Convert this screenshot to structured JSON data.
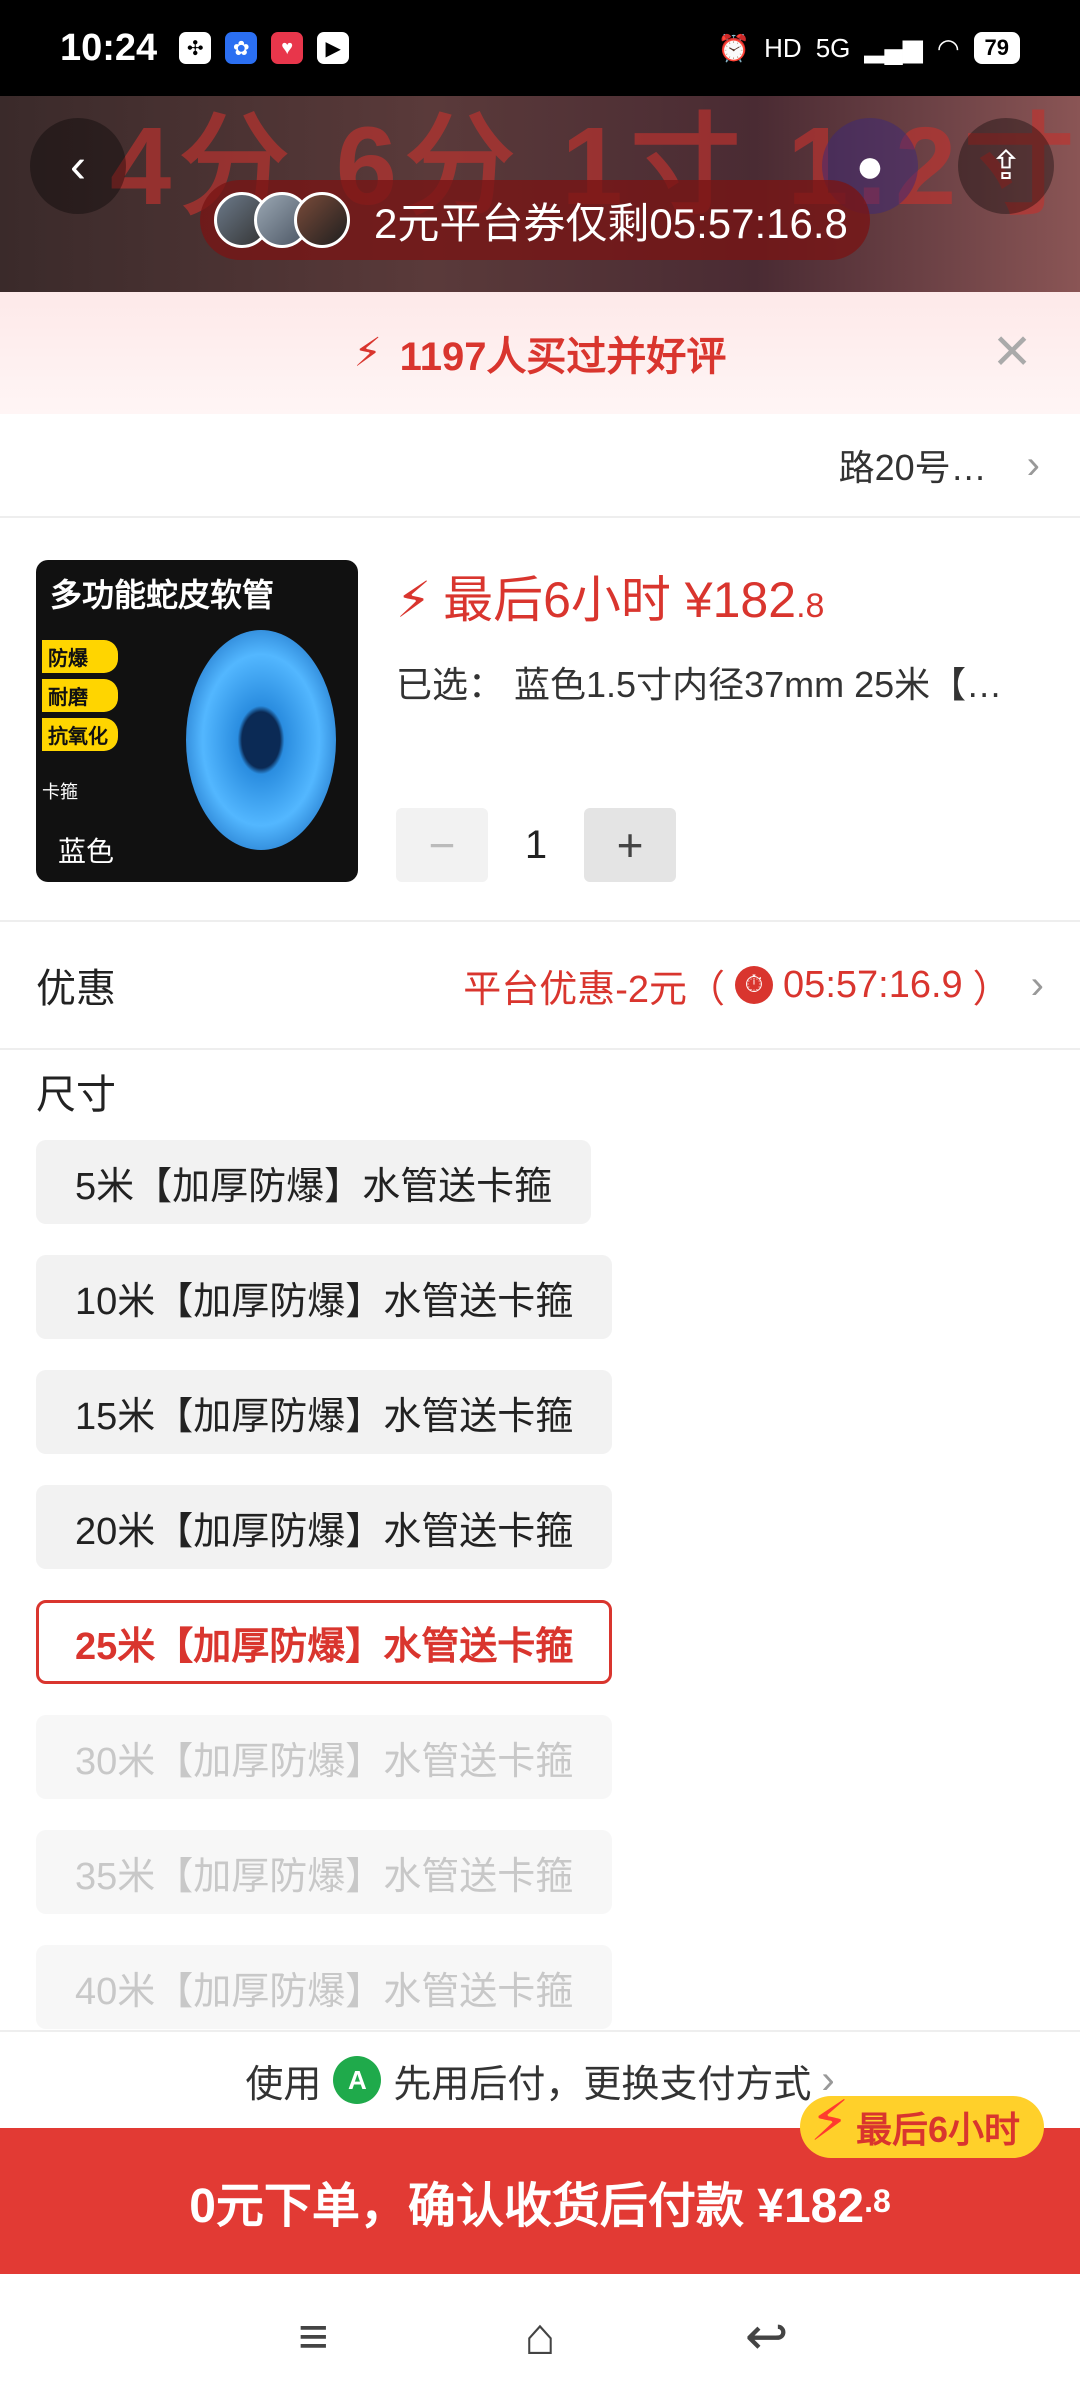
{
  "status_bar": {
    "time": "10:24",
    "network": "5G",
    "battery": "79"
  },
  "banner": {
    "bg_text": "4分 6分 1寸 1.2寸",
    "coupon_text": "2元平台券仅剩05:57:16.8"
  },
  "sales_strip": {
    "text": "1197人买过并好评"
  },
  "address": {
    "text": "路20号…"
  },
  "product": {
    "thumb_title": "多功能蛇皮软管",
    "thumb_tags": [
      "防爆",
      "耐磨",
      "抗氧化"
    ],
    "thumb_clamp": "卡箍",
    "thumb_color": "蓝色",
    "price_prefix": "最后6小时 ¥",
    "price_main": "182",
    "price_decimal": ".8",
    "selected_label": "已选：",
    "selected_value": "蓝色1.5寸内径37mm 25米【…",
    "quantity": "1",
    "minus": "−",
    "plus": "+"
  },
  "promotion": {
    "label": "优惠",
    "value": "平台优惠-2元（",
    "countdown": "05:57:16.9",
    "close_paren": "）"
  },
  "size": {
    "title": "尺寸",
    "options": [
      {
        "label": "5米【加厚防爆】水管送卡箍",
        "state": "normal"
      },
      {
        "label": "10米【加厚防爆】水管送卡箍",
        "state": "normal"
      },
      {
        "label": "15米【加厚防爆】水管送卡箍",
        "state": "normal"
      },
      {
        "label": "20米【加厚防爆】水管送卡箍",
        "state": "normal"
      },
      {
        "label": "25米【加厚防爆】水管送卡箍",
        "state": "selected"
      },
      {
        "label": "30米【加厚防爆】水管送卡箍",
        "state": "disabled"
      },
      {
        "label": "35米【加厚防爆】水管送卡箍",
        "state": "disabled"
      },
      {
        "label": "40米【加厚防爆】水管送卡箍",
        "state": "disabled"
      }
    ]
  },
  "payment_hint": {
    "prefix": "使用",
    "text": "先用后付，更换支付方式",
    "icon": "A"
  },
  "cta": {
    "text": "0元下单，确认收货后付款 ¥182",
    "decimal": ".8",
    "badge": "最后6小时"
  },
  "colors": {
    "accent": "#d9352e",
    "cta_bg": "#e23a34",
    "badge_bg": "#ffd02a"
  }
}
